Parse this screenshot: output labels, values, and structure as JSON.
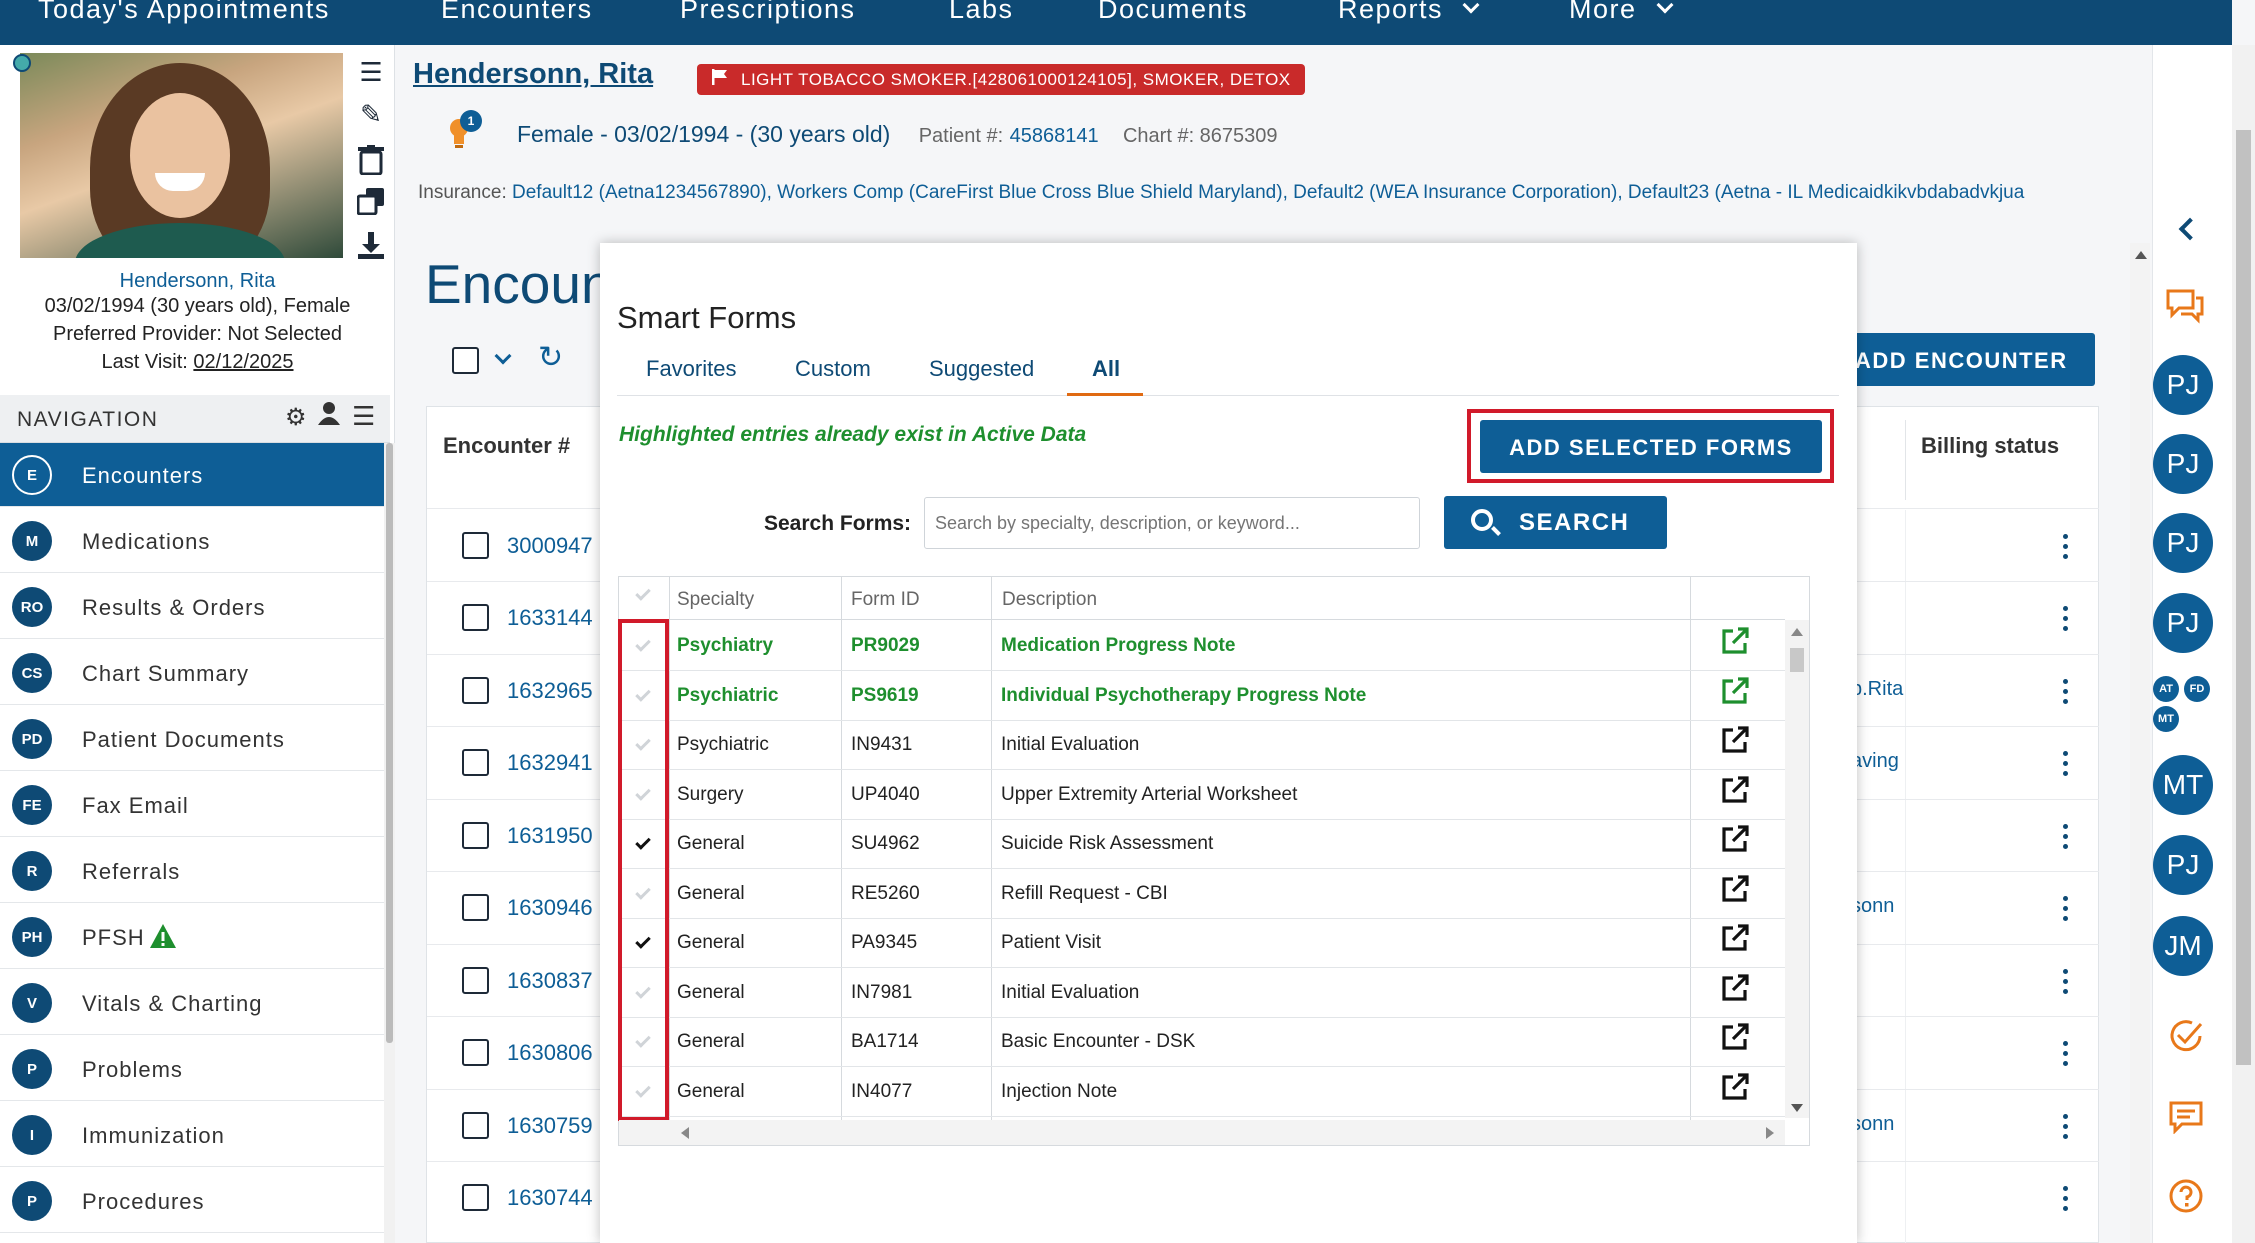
{
  "topnav": {
    "items": [
      "Today's Appointments",
      "Encounters",
      "Prescriptions",
      "Labs",
      "Documents",
      "Reports",
      "More"
    ]
  },
  "patient": {
    "name": "Hendersonn, Rita",
    "alert": "LIGHT TOBACCO SMOKER.[428061000124105], SMOKER, DETOX",
    "alert_count": "1",
    "demographics": "Female - 03/02/1994 - (30 years old)",
    "patient_label": "Patient #:",
    "patient_no": "45868141",
    "chart_label": "Chart #: 8675309",
    "insurance_label": "Insurance:",
    "insurance": "Default12 (Aetna1234567890), Workers Comp (CareFirst Blue Cross Blue Shield Maryland), Default2 (WEA Insurance Corporation), Default23 (Aetna - IL Medicaidkikvbdabadvkjua"
  },
  "left": {
    "name": "Hendersonn, Rita",
    "dob": "03/02/1994 (30 years old), Female",
    "provider": "Preferred Provider: Not Selected",
    "last_visit_label": "Last Visit:",
    "last_visit": "02/12/2025",
    "nav_title": "NAVIGATION",
    "nav": [
      {
        "badge": "E",
        "label": "Encounters"
      },
      {
        "badge": "M",
        "label": "Medications"
      },
      {
        "badge": "RO",
        "label": "Results & Orders"
      },
      {
        "badge": "CS",
        "label": "Chart Summary"
      },
      {
        "badge": "PD",
        "label": "Patient Documents"
      },
      {
        "badge": "FE",
        "label": "Fax Email"
      },
      {
        "badge": "R",
        "label": "Referrals"
      },
      {
        "badge": "PH",
        "label": "PFSH"
      },
      {
        "badge": "V",
        "label": "Vitals & Charting"
      },
      {
        "badge": "P",
        "label": "Problems"
      },
      {
        "badge": "I",
        "label": "Immunization"
      },
      {
        "badge": "P",
        "label": "Procedures"
      }
    ]
  },
  "page": {
    "title": "Encounters",
    "add_button": "ADD ENCOUNTER",
    "col_encounter": "Encounter #",
    "col_billing": "Billing status",
    "encounters": [
      "3000947",
      "1633144",
      "1632965",
      "1632941",
      "1631950",
      "1630946",
      "1630837",
      "1630806",
      "1630759",
      "1630744"
    ],
    "billing_fragments": [
      "",
      "",
      "b.Rita",
      "aving",
      "",
      "sonn",
      "",
      "",
      "sonn",
      ""
    ]
  },
  "rail": {
    "avatars": [
      "PJ",
      "PJ",
      "PJ",
      "PJ",
      "MT",
      "PJ",
      "JM"
    ],
    "small_avatars": [
      "AT",
      "FD",
      "MT"
    ],
    "orange_color": "#e8781a"
  },
  "modal": {
    "title": "Smart Forms",
    "tabs": [
      "Favorites",
      "Custom",
      "Suggested",
      "All"
    ],
    "active_tab": "All",
    "hint": "Highlighted entries already exist in Active Data",
    "add_selected": "ADD SELECTED FORMS",
    "search_label": "Search Forms:",
    "search_placeholder": "Search by specialty, description, or keyword...",
    "search_button": "SEARCH",
    "columns": [
      "Specialty",
      "Form ID",
      "Description"
    ],
    "rows": [
      {
        "specialty": "Psychiatry",
        "form_id": "PR9029",
        "description": "Medication Progress Note",
        "highlighted": true,
        "checked": false
      },
      {
        "specialty": "Psychiatric",
        "form_id": "PS9619",
        "description": "Individual Psychotherapy Progress Note",
        "highlighted": true,
        "checked": false
      },
      {
        "specialty": "Psychiatric",
        "form_id": "IN9431",
        "description": "Initial Evaluation",
        "highlighted": false,
        "checked": false
      },
      {
        "specialty": "Surgery",
        "form_id": "UP4040",
        "description": "Upper Extremity Arterial Worksheet",
        "highlighted": false,
        "checked": false
      },
      {
        "specialty": "General",
        "form_id": "SU4962",
        "description": "Suicide Risk Assessment",
        "highlighted": false,
        "checked": true
      },
      {
        "specialty": "General",
        "form_id": "RE5260",
        "description": "Refill Request - CBI",
        "highlighted": false,
        "checked": false
      },
      {
        "specialty": "General",
        "form_id": "PA9345",
        "description": "Patient Visit",
        "highlighted": false,
        "checked": true
      },
      {
        "specialty": "General",
        "form_id": "IN7981",
        "description": "Initial Evaluation",
        "highlighted": false,
        "checked": false
      },
      {
        "specialty": "General",
        "form_id": "BA1714",
        "description": "Basic Encounter - DSK",
        "highlighted": false,
        "checked": false
      },
      {
        "specialty": "General",
        "form_id": "IN4077",
        "description": "Injection Note",
        "highlighted": false,
        "checked": false
      }
    ],
    "highlight_color": "#1e8f2e",
    "annotation_color": "#d11a2a"
  }
}
